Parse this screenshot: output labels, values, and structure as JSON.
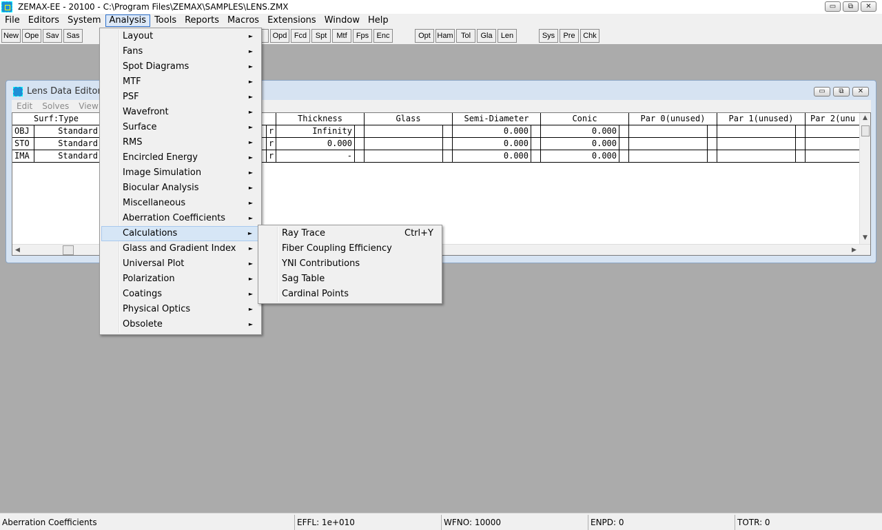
{
  "window": {
    "title": "ZEMAX-EE - 20100 - C:\\Program Files\\ZEMAX\\SAMPLES\\LENS.ZMX",
    "minimize": "▭",
    "maximize": "⧉",
    "close": "✕"
  },
  "menubar": [
    "File",
    "Editors",
    "System",
    "Analysis",
    "Tools",
    "Reports",
    "Macros",
    "Extensions",
    "Window",
    "Help"
  ],
  "toolbar": {
    "group1": [
      "New",
      "Ope",
      "Sav",
      "Sas"
    ],
    "group2": [
      "y",
      "Opd",
      "Fcd",
      "Spt",
      "Mtf",
      "Fps",
      "Enc"
    ],
    "group3": [
      "Opt",
      "Ham",
      "Tol",
      "Gla",
      "Len"
    ],
    "group4": [
      "Sys",
      "Pre",
      "Chk"
    ]
  },
  "lens_editor": {
    "title": "Lens Data Editor",
    "menu": [
      "Edit",
      "Solves",
      "View"
    ],
    "headers": [
      "Surf:Type",
      "",
      "Thickness",
      "Glass",
      "Semi-Diameter",
      "Conic",
      "Par 0(unused)",
      "Par 1(unused)",
      "Par 2(unu"
    ],
    "rows": [
      {
        "surf": "OBJ",
        "type": "Standard",
        "solve": "r",
        "thickness": "Infinity",
        "glass": "",
        "semi": "0.000",
        "conic": "0.000"
      },
      {
        "surf": "STO",
        "type": "Standard",
        "solve": "r",
        "thickness": "0.000",
        "glass": "",
        "semi": "0.000",
        "conic": "0.000"
      },
      {
        "surf": "IMA",
        "type": "Standard",
        "solve": "r",
        "thickness": "-",
        "glass": "",
        "semi": "0.000",
        "conic": "0.000"
      }
    ]
  },
  "analysis_menu": [
    "Layout",
    "Fans",
    "Spot Diagrams",
    "MTF",
    "PSF",
    "Wavefront",
    "Surface",
    "RMS",
    "Encircled Energy",
    "Image Simulation",
    "Biocular Analysis",
    "Miscellaneous",
    "Aberration Coefficients",
    "Calculations",
    "Glass and Gradient Index",
    "Universal Plot",
    "Polarization",
    "Coatings",
    "Physical Optics",
    "Obsolete"
  ],
  "submenu_arrow": "►",
  "calculations_submenu": [
    {
      "label": "Ray Trace",
      "shortcut": "Ctrl+Y"
    },
    {
      "label": "Fiber Coupling Efficiency",
      "shortcut": ""
    },
    {
      "label": "YNI Contributions",
      "shortcut": ""
    },
    {
      "label": "Sag Table",
      "shortcut": ""
    },
    {
      "label": "Cardinal Points",
      "shortcut": ""
    }
  ],
  "statusbar": {
    "message": "Aberration Coefficients",
    "effl": "EFFL: 1e+010",
    "wfno": "WFNO: 10000",
    "enpd": "ENPD: 0",
    "totr": "TOTR: 0"
  }
}
